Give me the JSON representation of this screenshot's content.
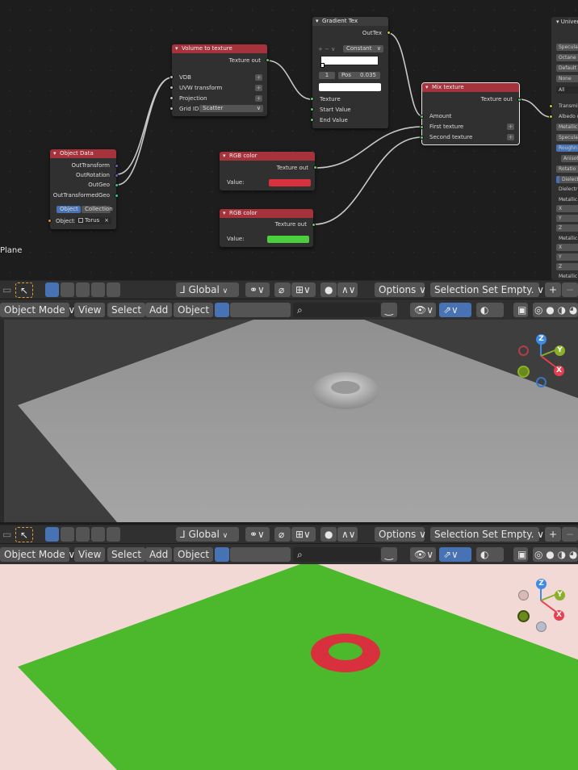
{
  "nodes": {
    "gradient": {
      "title": "Gradient Tex",
      "out": "OutTex",
      "interp": "Constant",
      "index": "1",
      "pos_label": "Pos",
      "pos_value": "0.035",
      "inputs": [
        "Texture",
        "Start Value",
        "End Value"
      ]
    },
    "volume": {
      "title": "Volume to texture",
      "out": "Texture out",
      "inputs": [
        "VDB",
        "UVW transform",
        "Projection"
      ],
      "grid_label": "Grid ID:",
      "grid_value": "Scatter"
    },
    "object_data": {
      "title": "Object Data",
      "outputs": [
        "OutTransform",
        "OutRotation",
        "OutGeo",
        "OutTransformedGeo"
      ],
      "tab_object": "Object",
      "tab_collection": "Collection",
      "object_label": "Object:",
      "object_value": "Torus"
    },
    "rgb1": {
      "title": "RGB color",
      "out": "Texture out",
      "value_label": "Value:",
      "color": "#d9303e"
    },
    "rgb2": {
      "title": "RGB color",
      "out": "Texture out",
      "value_label": "Value:",
      "color": "#4ccf3c"
    },
    "mix": {
      "title": "Mix texture",
      "out": "Texture out",
      "inputs": [
        "Amount",
        "First texture",
        "Second texture"
      ]
    },
    "universal": {
      "title": "Univers",
      "rows": [
        "Specula",
        "Octane",
        "Default",
        "None",
        "All",
        "Transmis",
        "Albedo c",
        "Metallic",
        "Specula",
        "Roughn",
        "Anisot",
        "Rotatio",
        "Dielectr",
        "Dielectric",
        "Metallic I",
        "X",
        "Y",
        "Z",
        "Metallic I",
        "X",
        "Y",
        "Z",
        "Metallic I"
      ]
    }
  },
  "node_editor": {
    "active_object": "Plane"
  },
  "toolbar": {
    "transform_orientation": "Global",
    "options": "Options",
    "selection_set": "Selection Set Empty."
  },
  "header": {
    "mode": "Object Mode",
    "menu_view": "View",
    "menu_select": "Select",
    "menu_add": "Add",
    "menu_object": "Object"
  },
  "gizmo": {
    "z": "Z",
    "y": "Y",
    "x": "X"
  },
  "colors": {
    "rendered_background": "#f2d9d5",
    "plane_rendered": "#4cb82b",
    "torus_rendered": "#d9303e",
    "solid_background": "#3e3e3e",
    "plane_solid": "#9a9a9a"
  }
}
